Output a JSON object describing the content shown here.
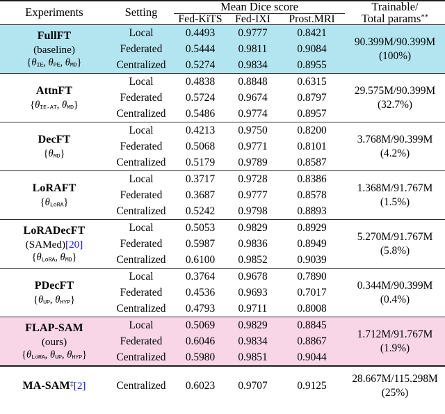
{
  "table": {
    "headers": {
      "experiments": "Experiments",
      "setting": "Setting",
      "mean_dice": "Mean Dice score",
      "fed_kits": "Fed-KiTS",
      "fed_ixi": "Fed-IXI",
      "prost_mri": "Prost.MRI",
      "trainable_line1": "Trainable/",
      "trainable_line2": "Total params",
      "trainable_marker": "**"
    },
    "settings": {
      "local": "Local",
      "federated": "Federated",
      "centralized": "Centralized"
    },
    "groups": [
      {
        "name": "FullFT",
        "sub": "(baseline)",
        "params_set": "{θIE, θPE, θMD}",
        "theta_subs": [
          "IE",
          "PE",
          "MD"
        ],
        "highlight": "blue",
        "fed_kits": [
          "0.4493",
          "0.5444",
          "0.5274"
        ],
        "fed_ixi": [
          "0.9777",
          "0.9811",
          "0.9834"
        ],
        "prost_mri": [
          "0.8421",
          "0.9084",
          "0.8955"
        ],
        "params_count": "90.399M/90.399M",
        "params_pct": "(100%)"
      },
      {
        "name": "AttnFT",
        "sub": "",
        "params_set": "{θIE-AT, θMD}",
        "theta_subs": [
          "IE-AT",
          "MD"
        ],
        "highlight": "none",
        "fed_kits": [
          "0.4838",
          "0.5724",
          "0.5486"
        ],
        "fed_ixi": [
          "0.8848",
          "0.9674",
          "0.9774"
        ],
        "prost_mri": [
          "0.6315",
          "0.8797",
          "0.8957"
        ],
        "params_count": "29.575M/90.399M",
        "params_pct": "(32.7%)"
      },
      {
        "name": "DecFT",
        "sub": "",
        "params_set": "{θMD}",
        "theta_subs": [
          "MD"
        ],
        "highlight": "none",
        "fed_kits": [
          "0.4213",
          "0.5068",
          "0.5179"
        ],
        "fed_ixi": [
          "0.9750",
          "0.9771",
          "0.9789"
        ],
        "prost_mri": [
          "0.8200",
          "0.8101",
          "0.8587"
        ],
        "params_count": "3.768M/90.399M",
        "params_pct": "(4.2%)"
      },
      {
        "name": "LoRAFT",
        "sub": "",
        "params_set": "{θLoRA}",
        "theta_subs": [
          "LoRA"
        ],
        "highlight": "none",
        "fed_kits": [
          "0.3717",
          "0.3687",
          "0.5242"
        ],
        "fed_ixi": [
          "0.9728",
          "0.9777",
          "0.9798"
        ],
        "prost_mri": [
          "0.8386",
          "0.8578",
          "0.8893"
        ],
        "params_count": "1.368M/91.767M",
        "params_pct": "(1.5%)"
      },
      {
        "name": "LoRADecFT",
        "sub": "(SAMed)",
        "sub_cite": "[20]",
        "params_set": "{θLoRA, θMD}",
        "theta_subs": [
          "LoRA",
          "MD"
        ],
        "highlight": "none",
        "fed_kits": [
          "0.5053",
          "0.5987",
          "0.6100"
        ],
        "fed_ixi": [
          "0.9829",
          "0.9836",
          "0.9852"
        ],
        "prost_mri": [
          "0.8929",
          "0.8949",
          "0.9039"
        ],
        "params_count": "5.270M/91.767M",
        "params_pct": "(5.8%)"
      },
      {
        "name": "PDecFT",
        "sub": "",
        "params_set": "{θUP, θHYP}",
        "theta_subs": [
          "UP",
          "HYP"
        ],
        "highlight": "none",
        "fed_kits": [
          "0.3764",
          "0.4536",
          "0.4793"
        ],
        "fed_ixi": [
          "0.9678",
          "0.9693",
          "0.9711"
        ],
        "prost_mri": [
          "0.7890",
          "0.7017",
          "0.8008"
        ],
        "params_count": "0.344M/90.399M",
        "params_pct": "(0.4%)"
      },
      {
        "name": "FLAP-SAM",
        "sub": "(ours)",
        "params_set": "{θLoRA, θUP, θHYP}",
        "theta_subs": [
          "LoRA",
          "UP",
          "HYP"
        ],
        "highlight": "pink",
        "fed_kits": [
          "0.5069",
          "0.6046",
          "0.5980"
        ],
        "fed_ixi": [
          "0.9829",
          "0.9834",
          "0.9851"
        ],
        "prost_mri": [
          "0.8845",
          "0.8867",
          "0.9044"
        ],
        "params_count": "1.712M/91.767M",
        "params_pct": "(1.9%)"
      }
    ],
    "final_row": {
      "name": "MA-SAM",
      "marker": "‡",
      "cite": "[2]",
      "setting": "Centralized",
      "fed_kits": "0.6023",
      "fed_ixi": "0.9707",
      "prost_mri": "0.9125",
      "params_count": "28.667M/115.298M",
      "params_pct": "(25%)"
    },
    "colors": {
      "highlight_blue": "#b2e5f0",
      "highlight_pink": "#f8d6e8",
      "citation": "#1414ff",
      "rule": "#1c1c1c"
    }
  }
}
